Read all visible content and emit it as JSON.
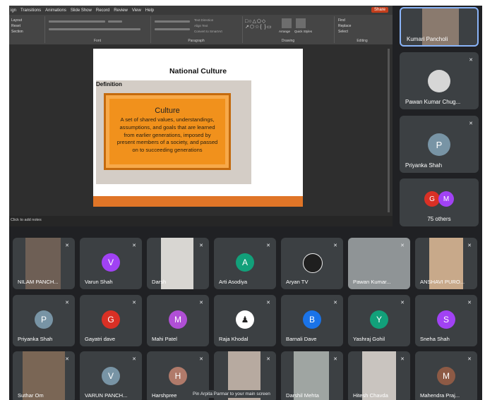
{
  "ribbon": {
    "tabs": [
      "ign",
      "Transitions",
      "Animations",
      "Slide Show",
      "Record",
      "Review",
      "View",
      "Help"
    ],
    "share_label": "Share",
    "groups": [
      "Font",
      "Paragraph",
      "Drawing",
      "Editing"
    ],
    "slide_cmds": [
      "Layout",
      "Reset",
      "Section"
    ],
    "editing_cmds": [
      "Find",
      "Replace",
      "Select"
    ],
    "drawing_cmds": [
      "Arrange",
      "Quick Styles"
    ],
    "paragraph_cmds": [
      "Text Direction",
      "Align Text",
      "Convert to SmartArt"
    ]
  },
  "slide": {
    "title": "National Culture",
    "definition_label": "Definition",
    "box_title": "Culture",
    "box_text": "A set of shared values, understandings, assumptions, and goals that are learned from earlier generations, imposed by present members of a society, and passed on to succeeding generations"
  },
  "notes_placeholder": "Click to add notes",
  "right_tiles": [
    {
      "name": "Kumari Pancholi"
    },
    {
      "name": "Pawan Kumar Chug..."
    },
    {
      "name": "Priyanka Shah",
      "initial": "P",
      "color": "#7894a5"
    },
    {
      "name": "75 others",
      "avatars": [
        {
          "initial": "G",
          "color": "#d93025"
        },
        {
          "initial": "M",
          "color": "#a142f4"
        }
      ]
    }
  ],
  "grid_tiles": [
    {
      "name": "NILAM PANCH..."
    },
    {
      "name": "Varun Shah",
      "initial": "V",
      "color": "#a142f4"
    },
    {
      "name": "Darsh"
    },
    {
      "name": "Arti Asodiya",
      "initial": "A",
      "color": "#12a07a"
    },
    {
      "name": "Aryan TV"
    },
    {
      "name": "Pawan Kumar..."
    },
    {
      "name": "ANSHAVI PURO..."
    },
    {
      "name": "Priyanka Shah",
      "initial": "P",
      "color": "#7894a5"
    },
    {
      "name": "Gayatri dave",
      "initial": "G",
      "color": "#d93025"
    },
    {
      "name": "Mahi Patel",
      "initial": "M",
      "color": "#b04fd6"
    },
    {
      "name": "Raja Khodal",
      "initial": "♟",
      "color": "#ffffff"
    },
    {
      "name": "Barnali Dave",
      "initial": "B",
      "color": "#1a73e8"
    },
    {
      "name": "Yashraj Gohil",
      "initial": "Y",
      "color": "#12a07a"
    },
    {
      "name": "Sneha Shah",
      "initial": "S",
      "color": "#a142f4"
    },
    {
      "name": "Suthar Om"
    },
    {
      "name": "VARUN PANCH...",
      "initial": "V",
      "color": "#7894a5"
    },
    {
      "name": "Harshpree",
      "initial": "H",
      "color": "#b07a6a"
    },
    {
      "name": ""
    },
    {
      "name": "Darshil Mehta"
    },
    {
      "name": "Hitesh Chavda"
    },
    {
      "name": "Mahendra Praj...",
      "initial": "M",
      "color": "#8d5a45"
    }
  ],
  "tooltip": "Pin Arpita Parmar to your main screen",
  "mic_off_icon": "mic-off-icon"
}
